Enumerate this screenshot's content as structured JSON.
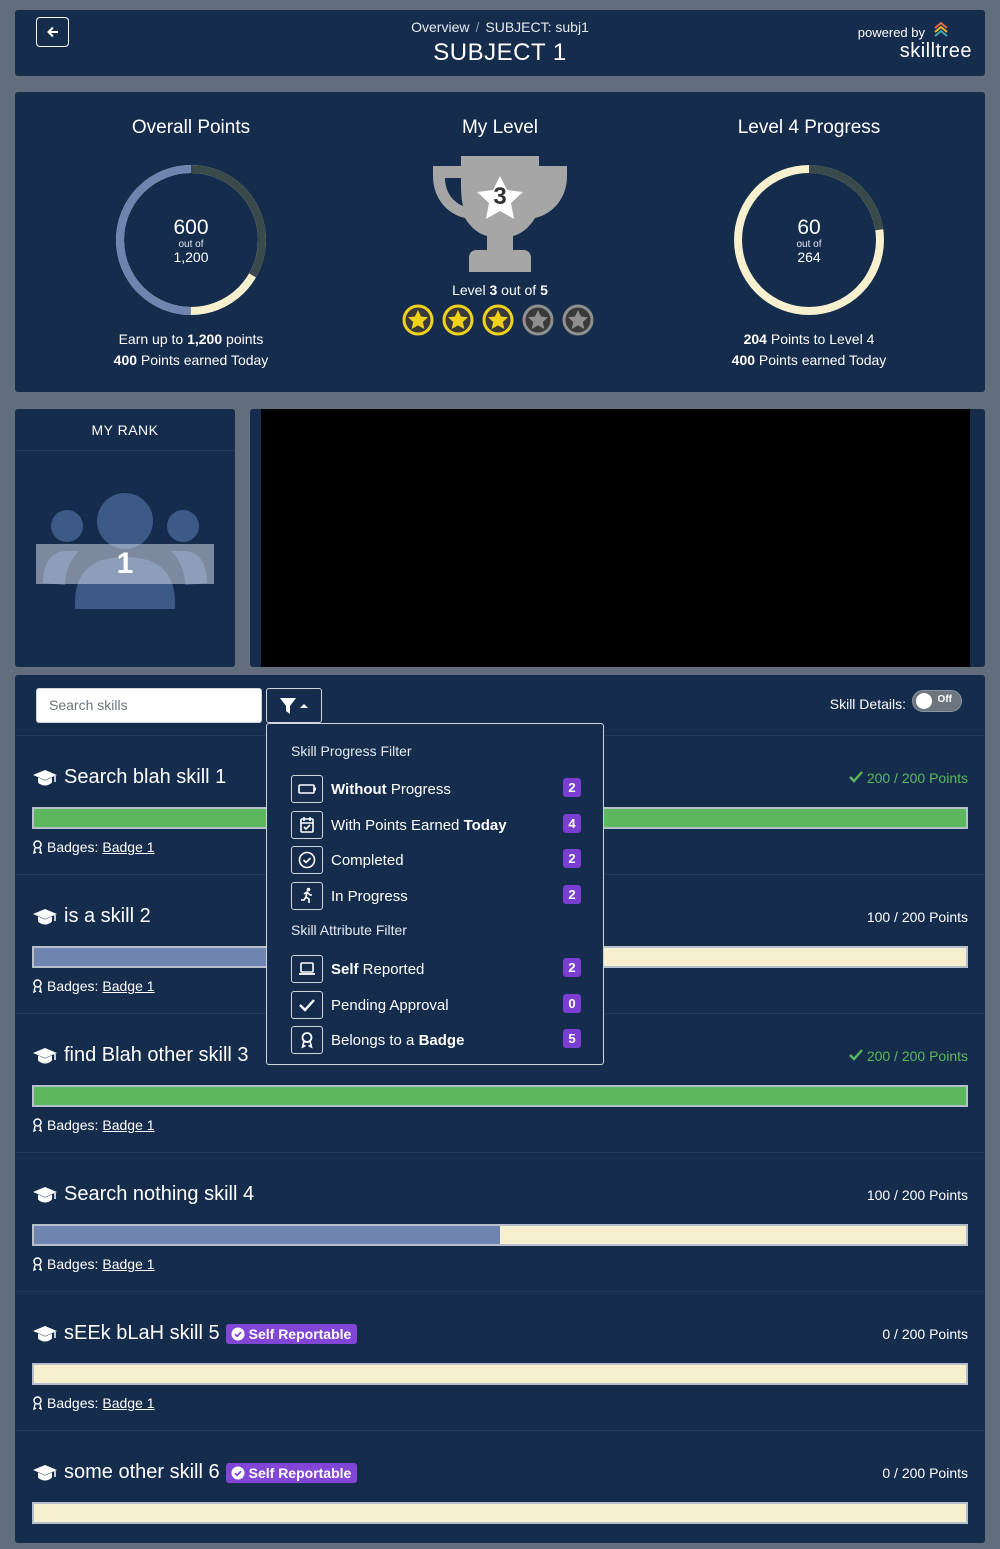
{
  "header": {
    "crumb_overview": "Overview",
    "crumb_sep": "/",
    "crumb_subject": "SUBJECT: subj1",
    "title": "SUBJECT 1",
    "powered_by": "powered by",
    "brand": "skilltree"
  },
  "stats": {
    "overall": {
      "title": "Overall Points",
      "value": "600",
      "out_of": "out of",
      "total": "1,200",
      "earn_pre": "Earn up to ",
      "earn_bold": "1,200",
      "earn_post": " points",
      "today_bold": "400",
      "today_post": " Points earned Today",
      "progress_fraction": 0.5,
      "today_fraction": 0.333
    },
    "my_level": {
      "title": "My Level",
      "level": "3",
      "level_pre": "Level ",
      "level_bold": "3",
      "level_mid": " out of ",
      "level_max": "5",
      "stars_earned": 3,
      "stars_total": 5
    },
    "level_progress": {
      "title": "Level 4 Progress",
      "value": "60",
      "out_of": "out of",
      "total": "264",
      "to_level_bold": "204",
      "to_level_post": " Points to Level 4",
      "today_bold": "400",
      "today_post": " Points earned Today",
      "progress_fraction": 0.227
    }
  },
  "rank": {
    "title": "MY RANK",
    "value": "1"
  },
  "skills_panel": {
    "search_placeholder": "Search skills",
    "details_label": "Skill Details:",
    "toggle_label": "Off"
  },
  "filter_menu": {
    "progress_heading": "Skill Progress Filter",
    "attribute_heading": "Skill Attribute Filter",
    "items": [
      {
        "icon": "battery-empty-icon",
        "bold_pre": "Without",
        "text": " Progress",
        "bold_post": "",
        "count": "2"
      },
      {
        "icon": "calendar-check-icon",
        "bold_pre": "",
        "text": "With Points Earned ",
        "bold_post": "Today",
        "count": "4"
      },
      {
        "icon": "check-circle-icon",
        "bold_pre": "",
        "text": "Completed",
        "bold_post": "",
        "count": "2"
      },
      {
        "icon": "running-icon",
        "bold_pre": "",
        "text": "In Progress",
        "bold_post": "",
        "count": "2"
      },
      {
        "icon": "laptop-icon",
        "bold_pre": "Self",
        "text": " Reported",
        "bold_post": "",
        "count": "2"
      },
      {
        "icon": "check-icon",
        "bold_pre": "",
        "text": "Pending Approval",
        "bold_post": "",
        "count": "0"
      },
      {
        "icon": "award-icon",
        "bold_pre": "",
        "text": "Belongs to a ",
        "bold_post": "Badge",
        "count": "5"
      }
    ]
  },
  "skills": [
    {
      "name": "Search blah skill 1",
      "points": "200 / 200 Points",
      "fraction": 1.0,
      "complete": true,
      "self_reportable": false,
      "badges_label": "Badges:",
      "badge": "Badge 1"
    },
    {
      "name": "is a skill 2",
      "points": "100 / 200 Points",
      "fraction": 0.5,
      "complete": false,
      "self_reportable": false,
      "badges_label": "Badges:",
      "badge": "Badge 1"
    },
    {
      "name": "find Blah other skill 3",
      "points": "200 / 200 Points",
      "fraction": 1.0,
      "complete": true,
      "self_reportable": false,
      "badges_label": "Badges:",
      "badge": "Badge 1"
    },
    {
      "name": "Search nothing skill 4",
      "points": "100 / 200 Points",
      "fraction": 0.5,
      "complete": false,
      "self_reportable": false,
      "badges_label": "Badges:",
      "badge": "Badge 1"
    },
    {
      "name": "sEEk bLaH skill 5",
      "points": "0 / 200 Points",
      "fraction": 0.0,
      "complete": false,
      "self_reportable": true,
      "self_label": "Self Reportable",
      "badges_label": "Badges:",
      "badge": "Badge 1"
    },
    {
      "name": "some other skill 6",
      "points": "0 / 200 Points",
      "fraction": 0.0,
      "complete": false,
      "self_reportable": true,
      "self_label": "Self Reportable",
      "badges_label": "",
      "badge": ""
    }
  ],
  "colors": {
    "page_bg": "#636e7d",
    "card_bg": "#152c4c",
    "complete_green": "#5cb85c",
    "progress_blue": "#6f85b0",
    "ring_cream": "#f6f0cf",
    "ring_dark": "#3a4a4a",
    "badge_purple": "#7a3ed3",
    "star_gold": "#f1d21b"
  }
}
